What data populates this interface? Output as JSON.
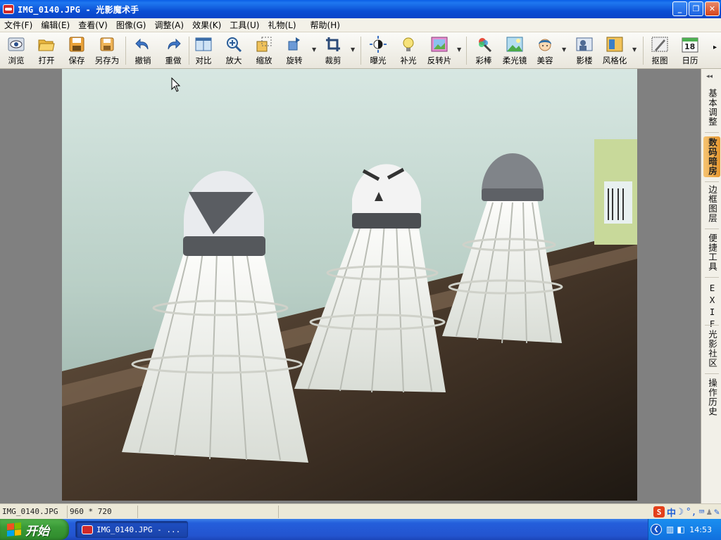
{
  "window": {
    "title": "IMG_0140.JPG - 光影魔术手",
    "buttons": {
      "minimize": "_",
      "maximize": "❐",
      "close": "✕"
    }
  },
  "menu": [
    "文件(F)",
    "编辑(E)",
    "查看(V)",
    "图像(G)",
    "调整(A)",
    "效果(K)",
    "工具(U)",
    "礼物(L)",
    "帮助(H)"
  ],
  "toolbar": {
    "items": [
      {
        "label": "浏览",
        "icon": "eye-icon"
      },
      {
        "label": "打开",
        "icon": "folder-open-icon"
      },
      {
        "label": "保存",
        "icon": "save-icon"
      },
      {
        "label": "另存为",
        "icon": "save-as-icon"
      },
      {
        "label": "撤销",
        "icon": "undo-icon"
      },
      {
        "label": "重做",
        "icon": "redo-icon"
      },
      {
        "label": "对比",
        "icon": "compare-icon"
      },
      {
        "label": "放大",
        "icon": "zoom-in-icon"
      },
      {
        "label": "缩放",
        "icon": "resize-icon"
      },
      {
        "label": "旋转",
        "icon": "rotate-icon"
      },
      {
        "label": "裁剪",
        "icon": "crop-icon"
      },
      {
        "label": "曝光",
        "icon": "exposure-icon"
      },
      {
        "label": "补光",
        "icon": "fill-light-icon"
      },
      {
        "label": "反转片",
        "icon": "reversal-film-icon"
      },
      {
        "label": "彩棒",
        "icon": "color-wand-icon"
      },
      {
        "label": "柔光镜",
        "icon": "soft-focus-icon"
      },
      {
        "label": "美容",
        "icon": "beauty-icon"
      },
      {
        "label": "影楼",
        "icon": "studio-icon"
      },
      {
        "label": "风格化",
        "icon": "stylize-icon"
      },
      {
        "label": "抠图",
        "icon": "cutout-icon"
      },
      {
        "label": "日历",
        "icon": "calendar-icon"
      }
    ],
    "calendar_day": "18",
    "more": "▸"
  },
  "side_tabs": [
    "基本调整",
    "数码暗房",
    "边框图层",
    "便捷工具",
    "EXIF",
    "光影社区",
    "操作历史"
  ],
  "side_active": "数码暗房",
  "status": {
    "filename": "IMG_0140.JPG",
    "dimensions": "960 * 720",
    "ime_lang": "中"
  },
  "taskbar": {
    "start_label": "开始",
    "task_label": "IMG_0140.JPG - ...",
    "time": "14:53"
  },
  "colors": {
    "titlebar": "#0b4fd4",
    "active_tab": "#e7972f",
    "start_button": "#3a9a37"
  }
}
